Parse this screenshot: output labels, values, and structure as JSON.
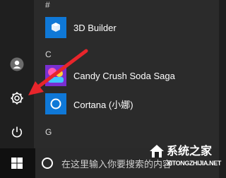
{
  "rail": {
    "icons": [
      "user-avatar-icon",
      "settings-gear-icon",
      "power-icon"
    ]
  },
  "sections": [
    {
      "letter": "#",
      "apps": [
        {
          "label": "3D Builder",
          "tile_color": "#0f78d7",
          "icon": "3d-builder-icon"
        }
      ]
    },
    {
      "letter": "C",
      "apps": [
        {
          "label": "Candy Crush Soda Saga",
          "tile_color": "#8a2be2",
          "icon": "candy-crush-icon"
        },
        {
          "label": "Cortana (小娜)",
          "tile_color": "#0f78d7",
          "icon": "cortana-icon"
        }
      ]
    },
    {
      "letter": "G",
      "apps": []
    }
  ],
  "taskbar": {
    "search_placeholder": "在这里输入你要搜索的内容",
    "search_icon": "cortana-circle-icon",
    "start_icon": "windows-logo-icon"
  },
  "overlay": {
    "arrow_color": "#e8252b"
  },
  "watermark": {
    "text_cn": "系统之家",
    "text_en": "XITONGZHIJIA.NET"
  }
}
